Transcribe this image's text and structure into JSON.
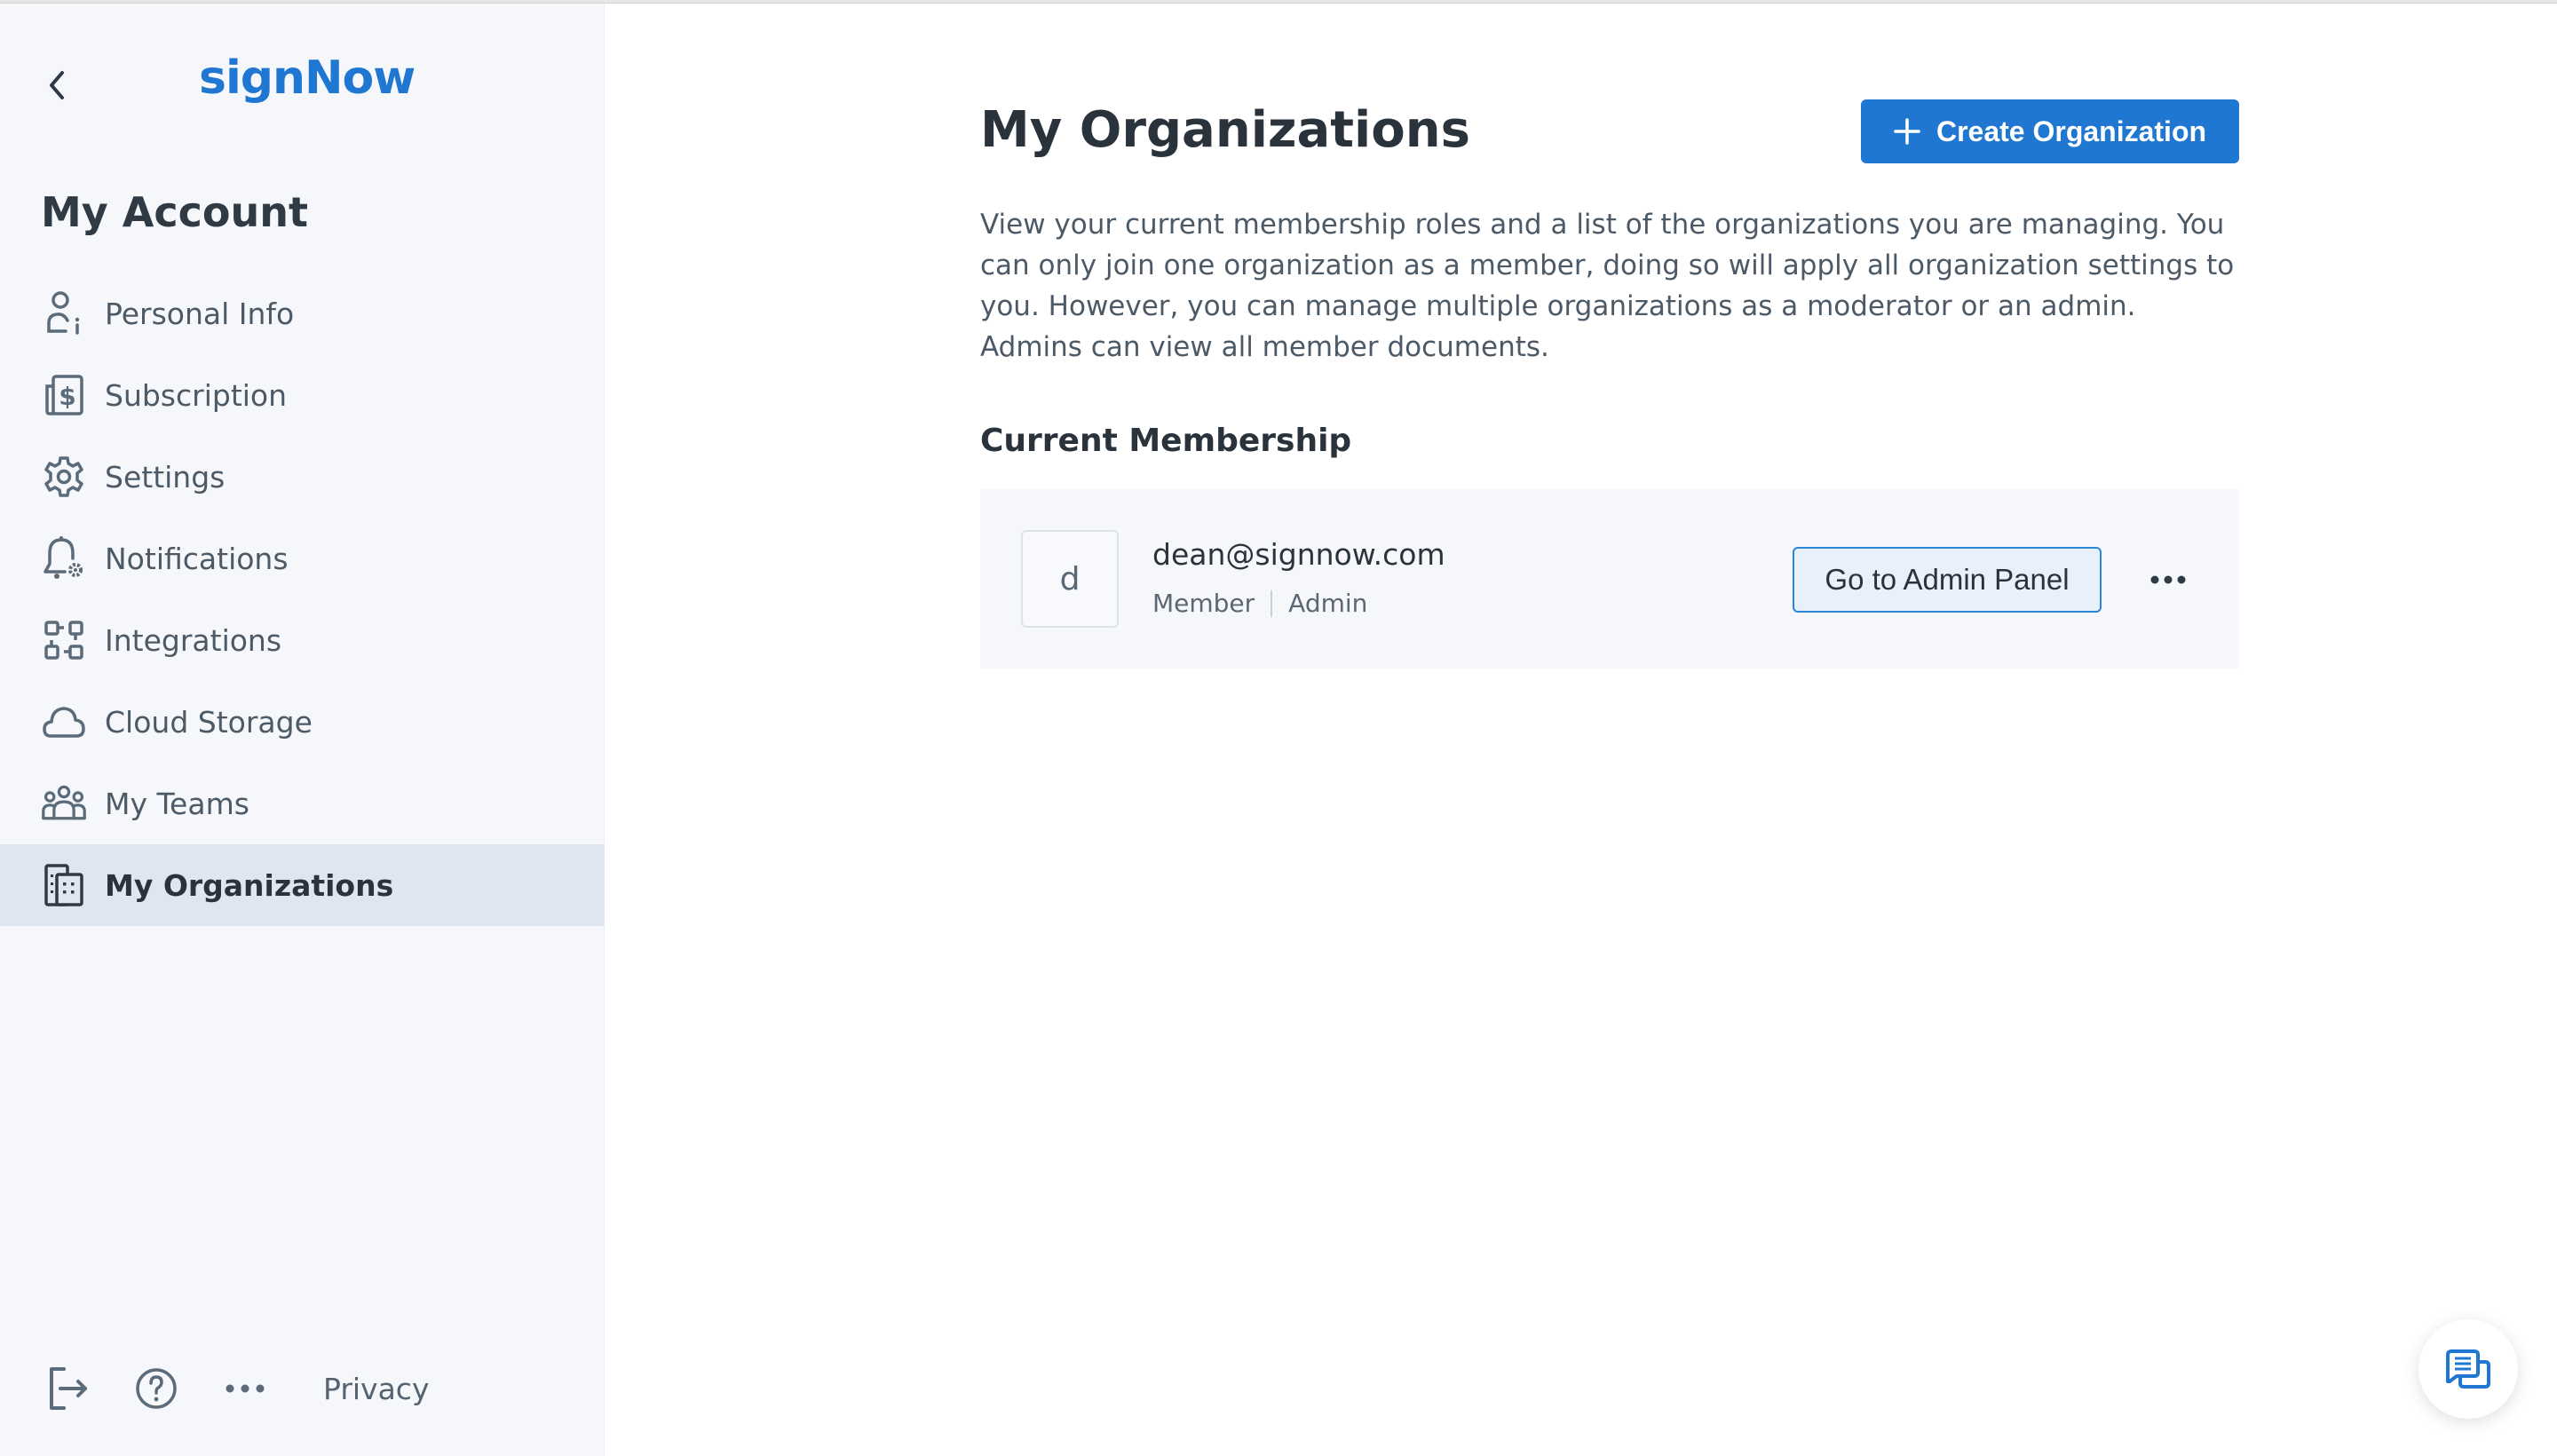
{
  "sidebar": {
    "logo": "signNow",
    "title": "My Account",
    "items": [
      {
        "label": "Personal Info",
        "icon": "person-info-icon"
      },
      {
        "label": "Subscription",
        "icon": "subscription-dollar-icon"
      },
      {
        "label": "Settings",
        "icon": "gear-icon"
      },
      {
        "label": "Notifications",
        "icon": "bell-gear-icon"
      },
      {
        "label": "Integrations",
        "icon": "integrations-icon"
      },
      {
        "label": "Cloud Storage",
        "icon": "cloud-icon"
      },
      {
        "label": "My Teams",
        "icon": "team-icon"
      },
      {
        "label": "My Organizations",
        "icon": "buildings-icon",
        "active": true
      }
    ],
    "footer": {
      "privacy_label": "Privacy"
    }
  },
  "main": {
    "title": "My Organizations",
    "create_button_label": "Create Organization",
    "description": "View your current membership roles and a list of the organizations you are managing. You can only join one organization as a member, doing so will apply all organization settings to you. However, you can manage multiple organizations as a moderator or an admin. Admins can view all member documents.",
    "section_title": "Current Membership",
    "membership": {
      "avatar_letter": "d",
      "email": "dean@signnow.com",
      "roles": [
        "Member",
        "Admin"
      ],
      "admin_button_label": "Go to Admin Panel"
    }
  },
  "colors": {
    "brand_blue": "#1f77d1",
    "sidebar_bg": "#f5f7fb",
    "active_item_bg": "#dfe6ef",
    "text_dark": "#2a333c",
    "text_muted": "#4c5a67"
  }
}
